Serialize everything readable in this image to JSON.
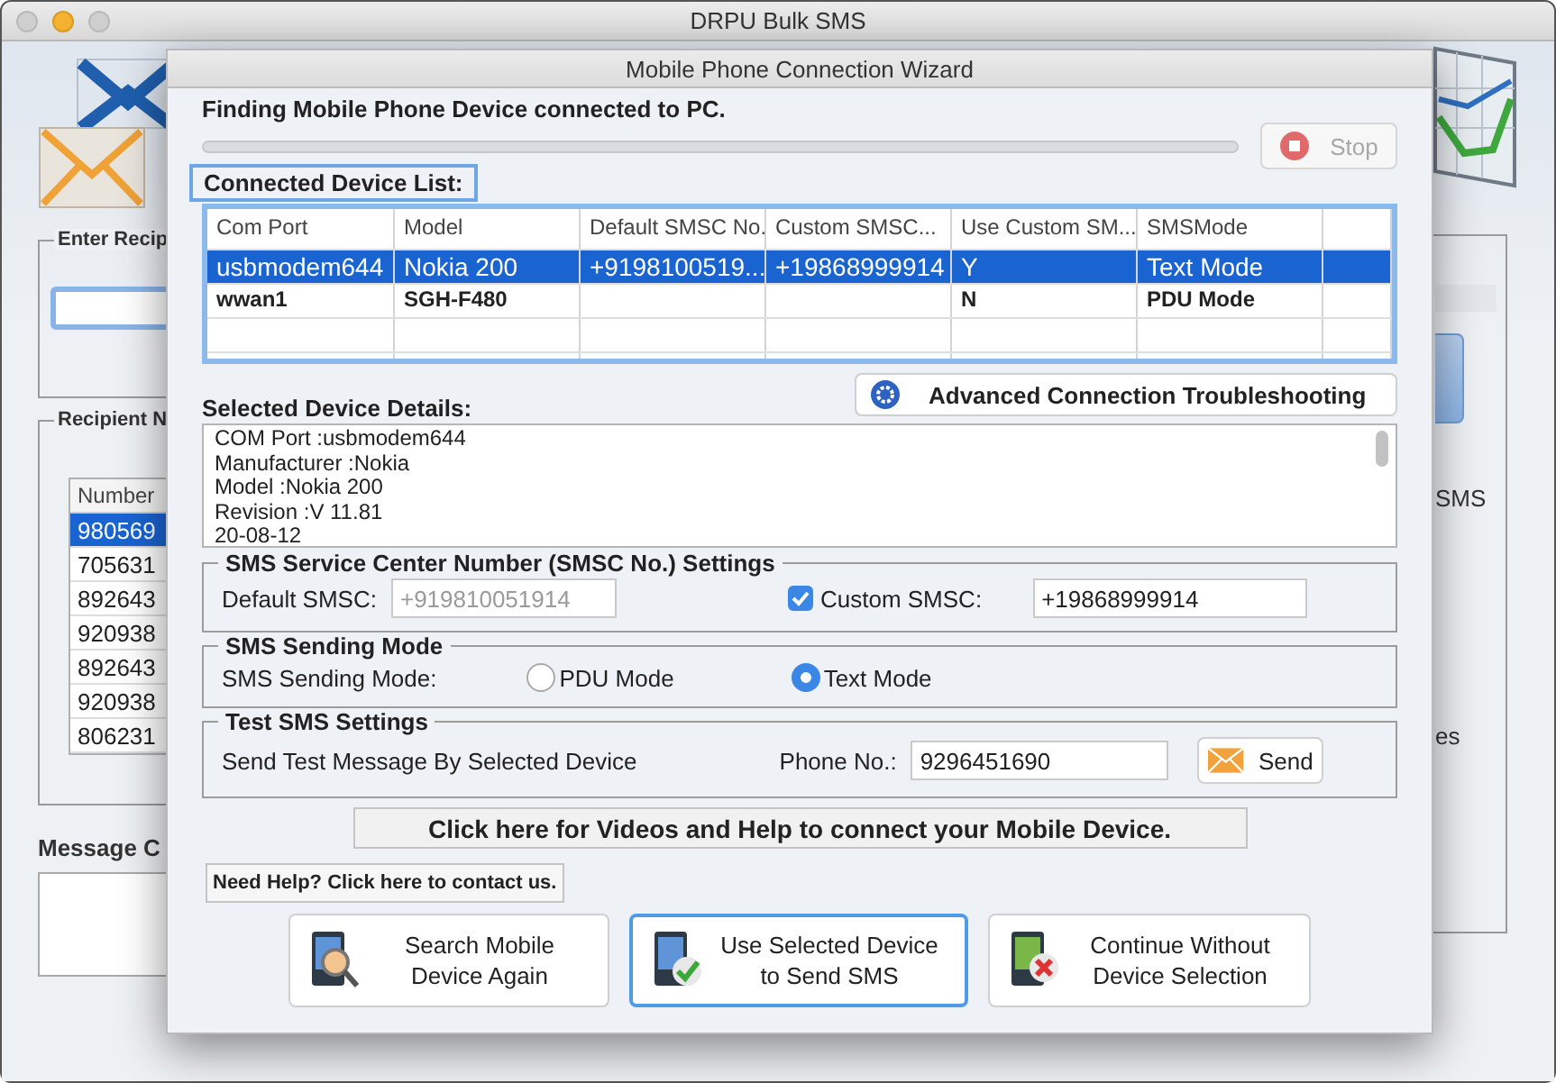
{
  "main_window": {
    "title": "DRPU Bulk SMS",
    "recipient_group": "Enter Recip",
    "recipient_list_group": "Recipient N",
    "number_column": "Number",
    "numbers": [
      {
        "value": "980569",
        "selected": true
      },
      {
        "value": "705631",
        "selected": false
      },
      {
        "value": "892643",
        "selected": false
      },
      {
        "value": "920938",
        "selected": false
      },
      {
        "value": "892643",
        "selected": false
      },
      {
        "value": "920938",
        "selected": false
      },
      {
        "value": "806231",
        "selected": false
      }
    ],
    "message_label": "Message C",
    "right_texts": [
      "SMS",
      "es"
    ]
  },
  "dialog": {
    "title": "Mobile Phone Connection Wizard",
    "status": "Finding Mobile Phone Device connected to PC.",
    "progress": {
      "level": 0
    },
    "stop_button": {
      "label": "Stop",
      "disabled": true
    },
    "device_list": {
      "label": "Connected Device List:",
      "columns": [
        "Com Port",
        "Model",
        "Default SMSC No.",
        "Custom SMSC...",
        "Use Custom SM...",
        "SMSMode"
      ],
      "rows": [
        {
          "cells": [
            "usbmodem644",
            "Nokia 200",
            "+9198100519...",
            "+19868999914",
            "Y",
            "Text Mode"
          ],
          "selected": true
        },
        {
          "cells": [
            "wwan1",
            "SGH-F480",
            null,
            null,
            "N",
            "PDU Mode"
          ],
          "selected": false
        }
      ]
    },
    "details": {
      "label": "Selected Device Details:",
      "lines": [
        "COM Port :usbmodem644",
        "Manufacturer :Nokia",
        "Model :Nokia 200",
        "Revision :V 11.81",
        "20-08-12"
      ]
    },
    "troubleshoot_button": "Advanced Connection Troubleshooting",
    "smsc_settings": {
      "title": "SMS Service Center Number (SMSC No.) Settings",
      "default_label": "Default SMSC:",
      "default_value": "+919810051914",
      "default_disabled": true,
      "custom_label": "Custom SMSC:",
      "custom_checked": true,
      "custom_value": "+19868999914"
    },
    "sending_mode": {
      "title": "SMS Sending Mode",
      "label": "SMS Sending Mode:",
      "options": [
        {
          "label": "PDU Mode",
          "selected": false
        },
        {
          "label": "Text Mode",
          "selected": true
        }
      ]
    },
    "test_sms": {
      "title": "Test SMS Settings",
      "label": "Send Test Message By Selected Device",
      "phone_label": "Phone No.:",
      "phone_value": "9296451690",
      "send_button": "Send"
    },
    "videos_link": "Click here for Videos and Help to connect your Mobile Device.",
    "help_link": "Need Help? Click here to contact us.",
    "actions": [
      {
        "kind": "search",
        "label_lines": [
          "Search Mobile",
          "Device Again"
        ],
        "focused": false
      },
      {
        "kind": "confirm",
        "label_lines": [
          "Use Selected Device",
          "to Send SMS"
        ],
        "focused": true
      },
      {
        "kind": "cancel",
        "label_lines": [
          "Continue Without",
          "Device Selection"
        ],
        "focused": false
      }
    ]
  }
}
